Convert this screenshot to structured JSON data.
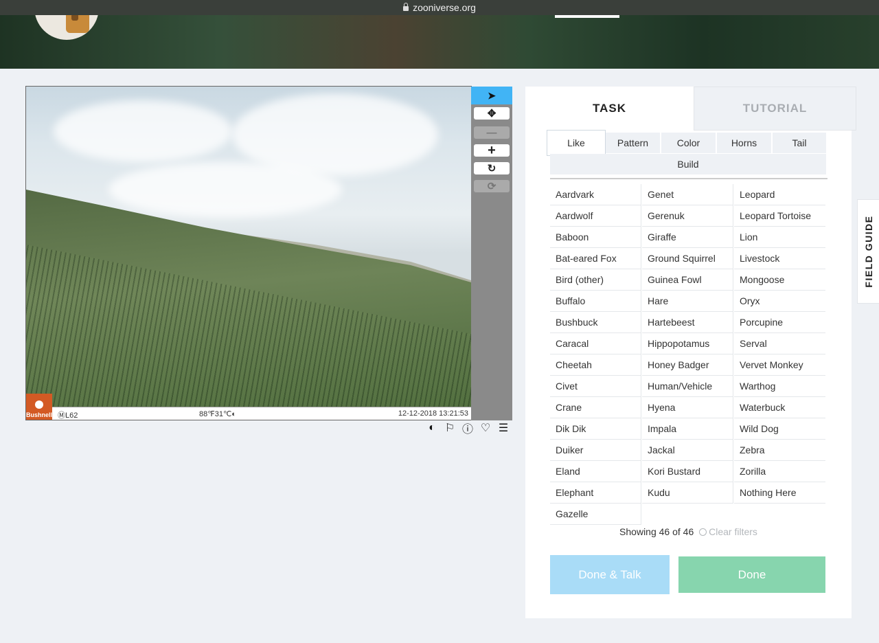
{
  "browser": {
    "url": "zooniverse.org"
  },
  "viewer": {
    "camera_brand": "Bushnell",
    "info_left": "ⓂL62",
    "info_mid": "88℉31℃◐",
    "timestamp": "12-12-2018 13:21:53"
  },
  "toolbar": {
    "tools": [
      {
        "name": "pointer",
        "glyph": "➤"
      },
      {
        "name": "move",
        "glyph": "✥"
      },
      {
        "name": "zoom-out",
        "glyph": "—"
      },
      {
        "name": "zoom-in",
        "glyph": "+"
      },
      {
        "name": "rotate",
        "glyph": "↻"
      },
      {
        "name": "reset",
        "glyph": "⟳"
      }
    ],
    "accent": "#41b4f5"
  },
  "subject_actions": {
    "icons": [
      "◐",
      "⚐",
      "ⓘ",
      "♡",
      "☰"
    ]
  },
  "tabs": {
    "task": "TASK",
    "tutorial": "TUTORIAL"
  },
  "filters": [
    "Like",
    "Pattern",
    "Color",
    "Horns",
    "Tail",
    "Build"
  ],
  "species": [
    [
      "Aardvark",
      "Genet",
      "Leopard"
    ],
    [
      "Aardwolf",
      "Gerenuk",
      "Leopard Tortoise"
    ],
    [
      "Baboon",
      "Giraffe",
      "Lion"
    ],
    [
      "Bat-eared Fox",
      "Ground Squirrel",
      "Livestock"
    ],
    [
      "Bird (other)",
      "Guinea Fowl",
      "Mongoose"
    ],
    [
      "Buffalo",
      "Hare",
      "Oryx"
    ],
    [
      "Bushbuck",
      "Hartebeest",
      "Porcupine"
    ],
    [
      "Caracal",
      "Hippopotamus",
      "Serval"
    ],
    [
      "Cheetah",
      "Honey Badger",
      "Vervet Monkey"
    ],
    [
      "Civet",
      "Human/Vehicle",
      "Warthog"
    ],
    [
      "Crane",
      "Hyena",
      "Waterbuck"
    ],
    [
      "Dik Dik",
      "Impala",
      "Wild Dog"
    ],
    [
      "Duiker",
      "Jackal",
      "Zebra"
    ],
    [
      "Eland",
      "Kori Bustard",
      "Zorilla"
    ],
    [
      "Elephant",
      "Kudu",
      "Nothing Here"
    ],
    [
      "Gazelle"
    ]
  ],
  "showing": {
    "text": "Showing 46 of 46",
    "clear": "Clear filters"
  },
  "buttons": {
    "done_talk": "Done & Talk",
    "done": "Done"
  },
  "field_guide": "FIELD GUIDE"
}
